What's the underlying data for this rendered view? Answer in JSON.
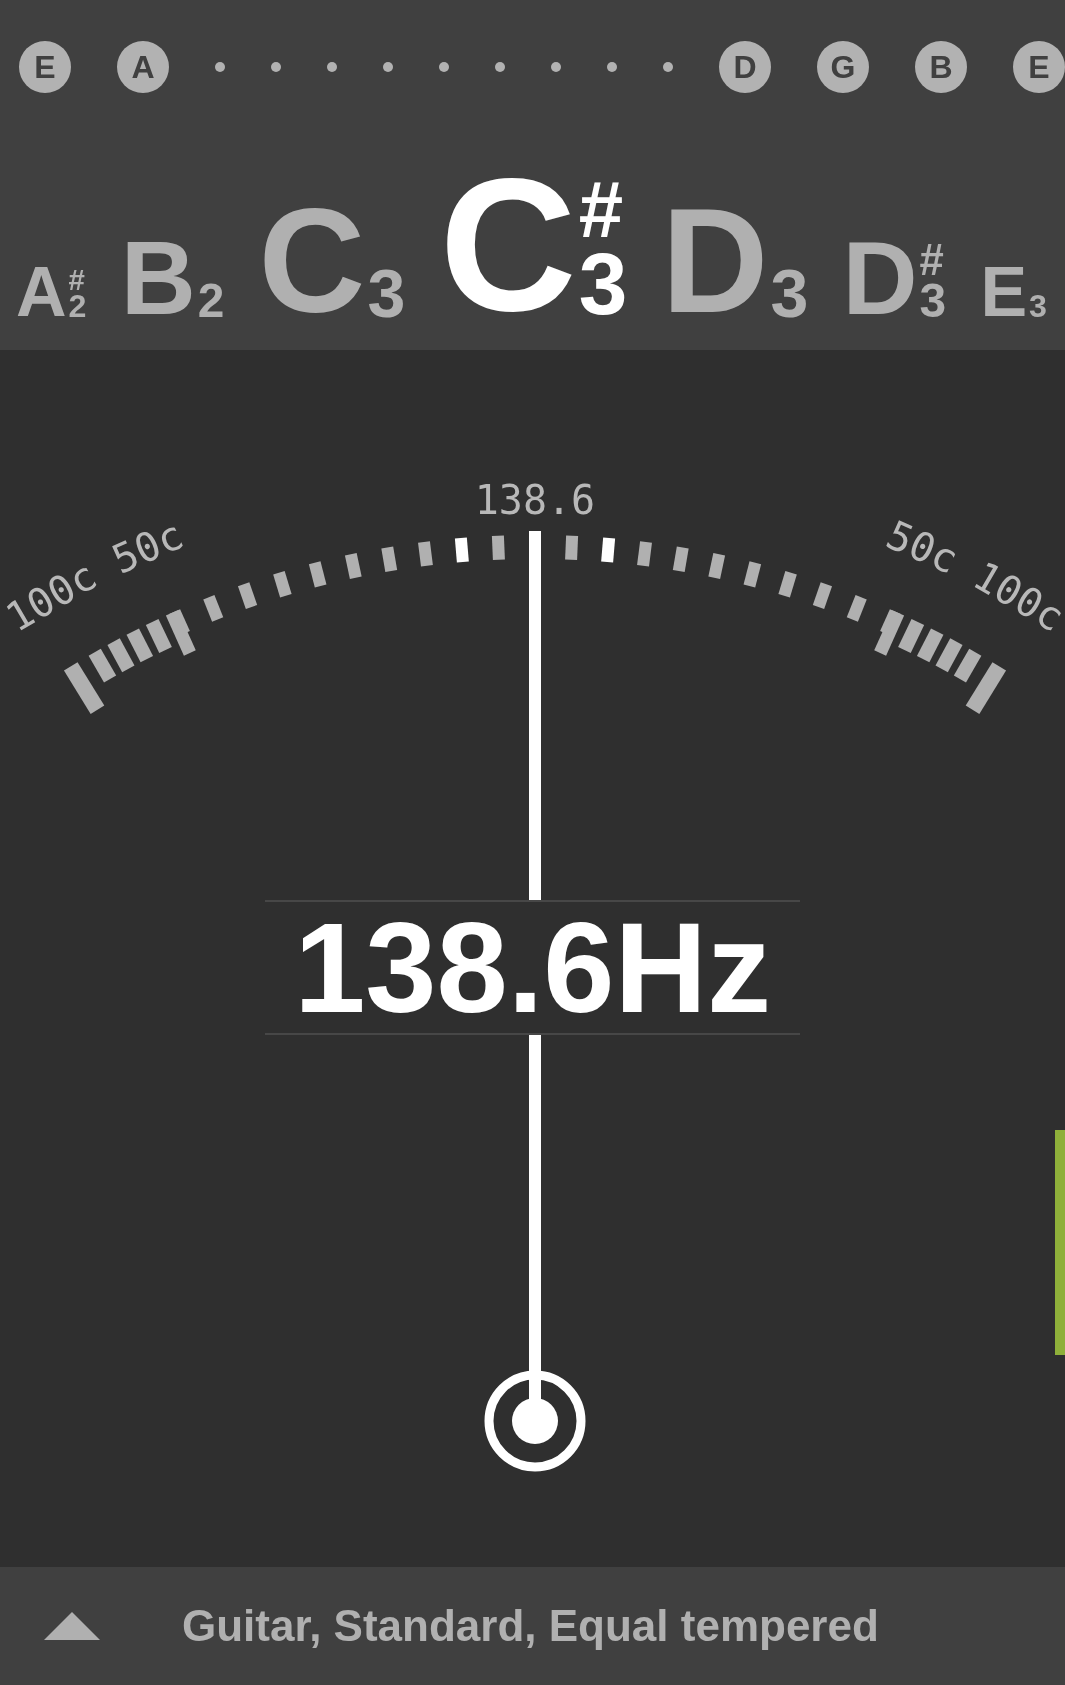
{
  "strings": [
    {
      "kind": "string",
      "label": "E"
    },
    {
      "kind": "string",
      "label": "A"
    },
    {
      "kind": "dot"
    },
    {
      "kind": "dot"
    },
    {
      "kind": "dot"
    },
    {
      "kind": "dot"
    },
    {
      "kind": "dot"
    },
    {
      "kind": "dot"
    },
    {
      "kind": "dot"
    },
    {
      "kind": "dot"
    },
    {
      "kind": "dot"
    },
    {
      "kind": "string",
      "label": "D"
    },
    {
      "kind": "string",
      "label": "G"
    },
    {
      "kind": "string",
      "label": "B"
    },
    {
      "kind": "string",
      "label": "E"
    }
  ],
  "notes": [
    {
      "name": "A",
      "octave": "2",
      "sharp": "#",
      "selected": false
    },
    {
      "name": "B",
      "octave": "2",
      "selected": false
    },
    {
      "name": "C",
      "octave": "3",
      "selected": false
    },
    {
      "name": "C",
      "octave": "3",
      "sharp": "#",
      "selected": true
    },
    {
      "name": "D",
      "octave": "3",
      "selected": false
    },
    {
      "name": "D",
      "octave": "3",
      "sharp": "#",
      "selected": false
    },
    {
      "name": "E",
      "octave": "3",
      "selected": false
    }
  ],
  "gauge": {
    "reference": "138.6",
    "scale_labels": [
      "100c",
      "50c",
      "50c",
      "100c"
    ]
  },
  "reading": "138.6Hz",
  "footer": {
    "label": "Guitar, Standard, Equal tempered"
  }
}
